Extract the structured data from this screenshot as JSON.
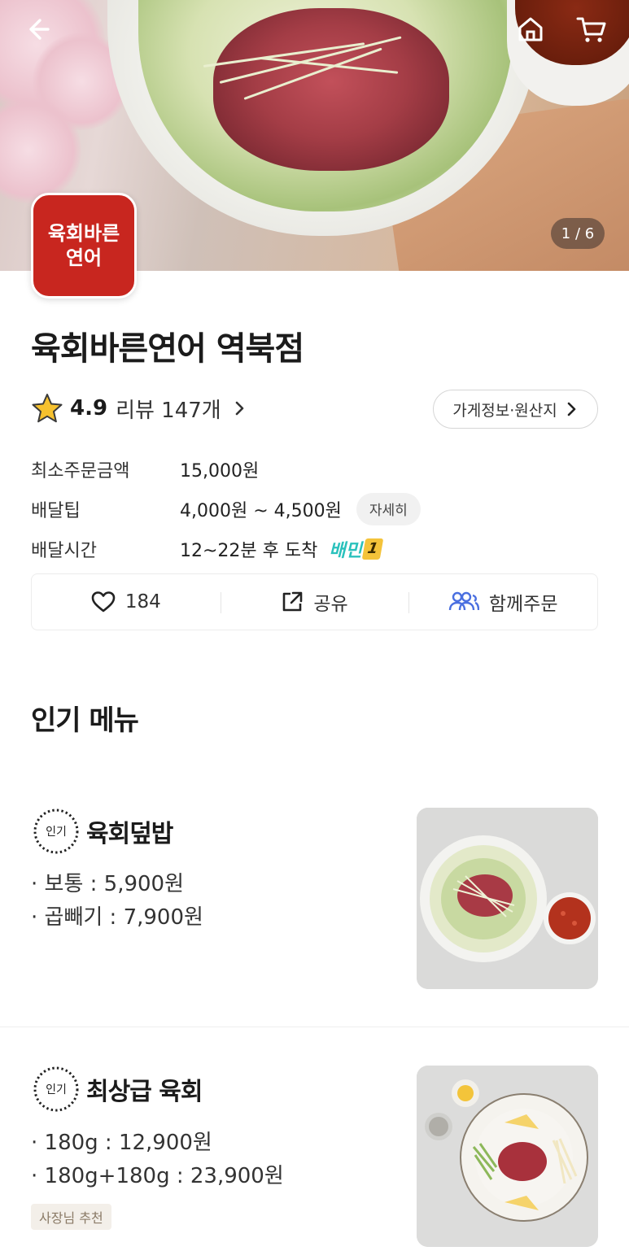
{
  "hero": {
    "pager_text": "1 / 6",
    "icons": {
      "back": "back-arrow-icon",
      "home": "home-icon",
      "cart": "cart-icon"
    }
  },
  "store": {
    "logo_line1": "육회바른",
    "logo_line2": "연어",
    "name": "육회바른연어 역북점",
    "rating": "4.9",
    "reviews": "리뷰 147개",
    "info_button": "가게정보·원산지",
    "rows": {
      "min_order_label": "최소주문금액",
      "min_order_value": "15,000원",
      "tip_label": "배달팁",
      "tip_value": "4,000원 ~ 4,500원",
      "tip_detail": "자세히",
      "time_label": "배달시간",
      "time_value": "12~22분 후 도착",
      "baemin": "배민",
      "baemin_one": "1"
    }
  },
  "actions": {
    "like_count": "184",
    "share": "공유",
    "group_order": "함께주문"
  },
  "section": {
    "title": "인기 메뉴"
  },
  "menu": [
    {
      "badge": "인기",
      "name": "육회덮밥",
      "prices": [
        "· 보통 : 5,900원",
        "· 곱빼기 : 7,900원"
      ]
    },
    {
      "badge": "인기",
      "name": "최상급 육회",
      "prices": [
        "· 180g : 12,900원",
        "· 180g+180g : 23,900원"
      ],
      "chip": "사장님 추천"
    }
  ],
  "colors": {
    "brand_red": "#c8261f",
    "baemin_mint": "#2ac1bc",
    "star": "#f6c12e",
    "group_blue": "#4a6fe0"
  }
}
